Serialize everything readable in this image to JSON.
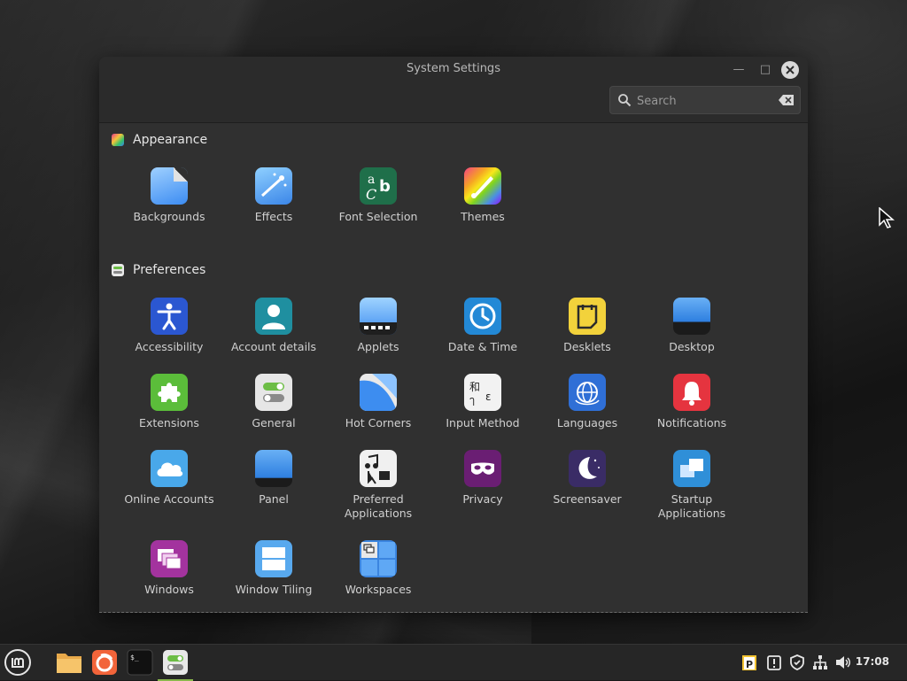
{
  "window": {
    "title": "System Settings",
    "search_placeholder": "Search"
  },
  "sections": {
    "appearance": {
      "label": "Appearance",
      "items": [
        {
          "label": "Backgrounds",
          "icon": "backgrounds-icon"
        },
        {
          "label": "Effects",
          "icon": "effects-icon"
        },
        {
          "label": "Font Selection",
          "icon": "font-selection-icon"
        },
        {
          "label": "Themes",
          "icon": "themes-icon"
        }
      ]
    },
    "preferences": {
      "label": "Preferences",
      "items": [
        {
          "label": "Accessibility",
          "icon": "accessibility-icon"
        },
        {
          "label": "Account details",
          "icon": "account-details-icon"
        },
        {
          "label": "Applets",
          "icon": "applets-icon"
        },
        {
          "label": "Date & Time",
          "icon": "clock-icon"
        },
        {
          "label": "Desklets",
          "icon": "desklets-icon"
        },
        {
          "label": "Desktop",
          "icon": "desktop-icon"
        },
        {
          "label": "Extensions",
          "icon": "puzzle-icon"
        },
        {
          "label": "General",
          "icon": "toggle-icon"
        },
        {
          "label": "Hot Corners",
          "icon": "hot-corners-icon"
        },
        {
          "label": "Input Method",
          "icon": "input-method-icon"
        },
        {
          "label": "Languages",
          "icon": "globe-icon"
        },
        {
          "label": "Notifications",
          "icon": "bell-icon"
        },
        {
          "label": "Online Accounts",
          "icon": "cloud-icon"
        },
        {
          "label": "Panel",
          "icon": "panel-icon"
        },
        {
          "label": "Preferred Applications",
          "icon": "preferred-apps-icon"
        },
        {
          "label": "Privacy",
          "icon": "mask-icon"
        },
        {
          "label": "Screensaver",
          "icon": "moon-icon"
        },
        {
          "label": "Startup Applications",
          "icon": "startup-apps-icon"
        },
        {
          "label": "Windows",
          "icon": "windows-icon"
        },
        {
          "label": "Window Tiling",
          "icon": "window-tiling-icon"
        },
        {
          "label": "Workspaces",
          "icon": "workspaces-icon"
        }
      ]
    }
  },
  "taskbar": {
    "clock": "17:08",
    "apps": [
      "menu-icon",
      "files-icon",
      "firefox-icon",
      "terminal-icon",
      "settings-icon"
    ],
    "tray": [
      "clipboard-icon",
      "update-icon",
      "shield-icon",
      "network-icon",
      "volume-icon"
    ]
  },
  "colors": {
    "window_bg": "#303030",
    "titlebar_bg": "#2b2b2b",
    "taskbar_bg": "#262626",
    "accent_green": "#88b64b"
  }
}
